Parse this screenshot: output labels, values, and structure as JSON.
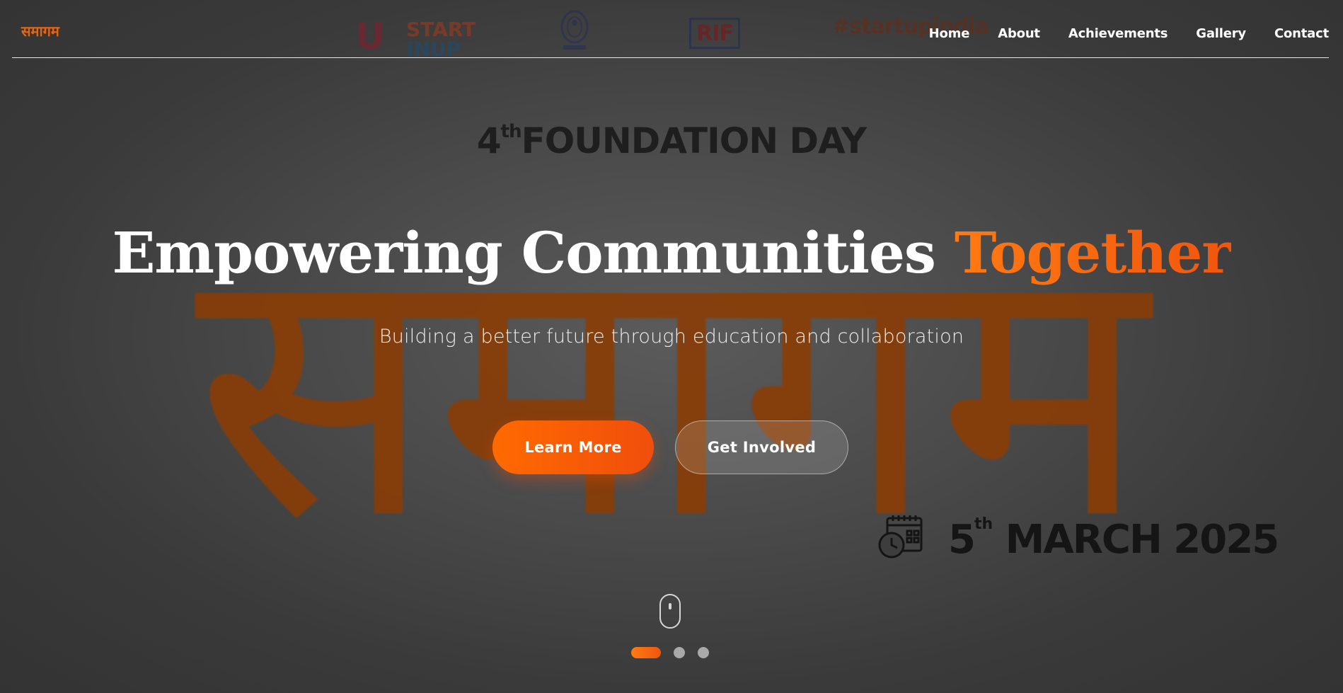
{
  "navbar": {
    "brand": "समागम",
    "links": [
      "Home",
      "About",
      "Achievements",
      "Gallery",
      "Contact"
    ]
  },
  "banner": {
    "partner_logos": [
      {
        "name": "START IN UP",
        "line1": "START",
        "line2": "INUP"
      },
      {
        "name": "emblem"
      },
      {
        "name": "RIF",
        "text": "RIF"
      },
      {
        "name": "startupindia",
        "text": "#startupindia"
      }
    ],
    "ordinal_number": "4",
    "ordinal_suffix": "th",
    "event_title": "FOUNDATION DAY",
    "watermark": "समागम",
    "date_day": "5",
    "date_suffix": "th",
    "date_rest": "MARCH 2025"
  },
  "hero": {
    "title_main": "Empowering Communities",
    "title_accent": "Together",
    "subtitle": "Building a better future through education and collaboration",
    "primary_button": "Learn More",
    "secondary_button": "Get Involved"
  },
  "carousel": {
    "slide_count": 3,
    "active_index": 0
  },
  "colors": {
    "accent": "#ff6a00",
    "accent_dark": "#f04e0c",
    "text": "#ffffff",
    "dot_inactive": "#a9a9a9"
  }
}
